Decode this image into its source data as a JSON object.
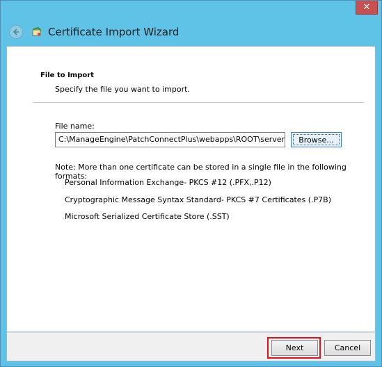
{
  "window": {
    "title": "Certificate Import Wizard",
    "close_glyph": "✕"
  },
  "icons": {
    "back": "back-arrow-icon",
    "wizard": "certificate-wizard-icon",
    "close": "close-icon"
  },
  "page": {
    "heading": "File to Import",
    "subheading": "Specify the file you want to import."
  },
  "file": {
    "label": "File name:",
    "value": "C:\\ManageEngine\\PatchConnectPlus\\webapps\\ROOT\\server-data\\",
    "browse_label": "Browse..."
  },
  "note": {
    "text": "Note:  More than one certificate can be stored in a single file in the following formats:",
    "formats": [
      "Personal Information Exchange- PKCS #12 (.PFX,.P12)",
      "Cryptographic Message Syntax Standard- PKCS #7 Certificates (.P7B)",
      "Microsoft Serialized Certificate Store (.SST)"
    ]
  },
  "footer": {
    "next_label": "Next",
    "cancel_label": "Cancel"
  },
  "colors": {
    "frame": "#5fc3e8",
    "close_button": "#c75050",
    "highlight": "#e0121e"
  }
}
